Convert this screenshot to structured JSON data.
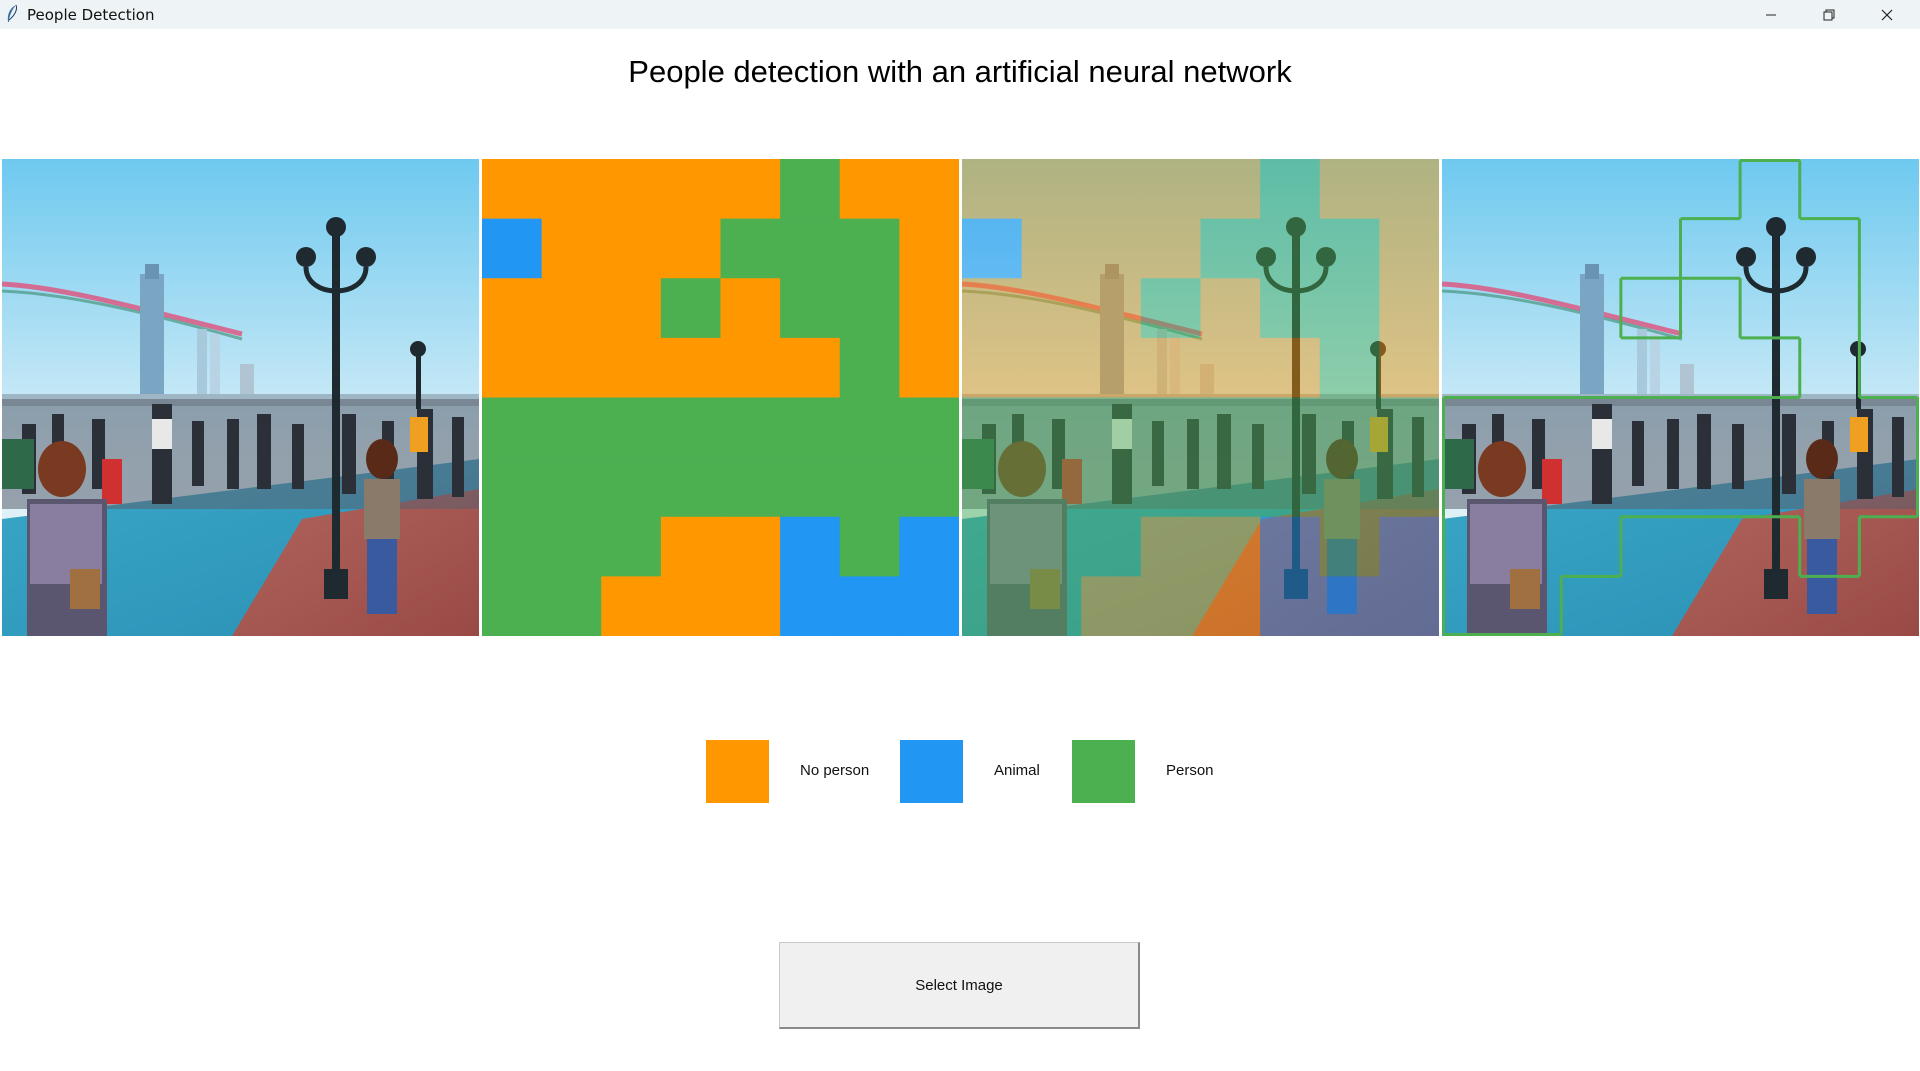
{
  "window": {
    "title": "People Detection",
    "controls": [
      "minimize-icon",
      "restore-icon",
      "close-icon"
    ]
  },
  "header": {
    "title": "People detection with an artificial neural network"
  },
  "colors": {
    "no_person": "#ff9800",
    "animal": "#2196f3",
    "person": "#4caf50",
    "box_outline": "#4caf50"
  },
  "classification_grid": {
    "rows": 8,
    "cols": 8,
    "legend": "N = No person, A = Animal, P = Person",
    "cells": [
      "NNNNNPNN",
      "ANNNPPPN",
      "NNNPNPPN",
      "NNNNNNPN",
      "PPPPPPPP",
      "PPPPPPPP",
      "PPPNNAPA",
      "PPNNNAAA"
    ]
  },
  "legend": {
    "items": [
      {
        "label": "No person",
        "color": "#ff9800"
      },
      {
        "label": "Animal",
        "color": "#2196f3"
      },
      {
        "label": "Person",
        "color": "#4caf50"
      }
    ]
  },
  "actions": {
    "select_label": "Select Image"
  }
}
